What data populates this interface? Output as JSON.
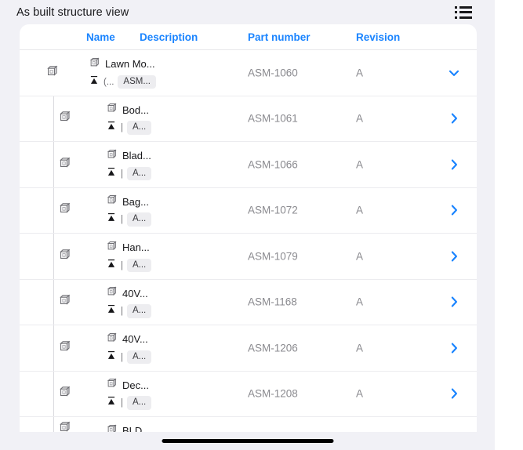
{
  "header": {
    "title": "As built structure view",
    "list_icon": "list-view-icon"
  },
  "table": {
    "columns": [
      {
        "key": "name",
        "label": "Name"
      },
      {
        "key": "description",
        "label": "Description"
      },
      {
        "key": "part_number",
        "label": "Part number"
      },
      {
        "key": "revision",
        "label": "Revision"
      }
    ],
    "rows": [
      {
        "level": 0,
        "name": "Lawn Mo...",
        "sub_prefix": "(...",
        "badge": "ASM...",
        "description": "",
        "part_number": "ASM-1060",
        "revision": "A",
        "expanded": true,
        "chevron": "chevron-down-icon"
      },
      {
        "level": 1,
        "name": "Bod...",
        "sub_prefix": "|",
        "badge": "A...",
        "description": "",
        "part_number": "ASM-1061",
        "revision": "A",
        "expanded": false,
        "chevron": "chevron-right-icon"
      },
      {
        "level": 1,
        "name": "Blad...",
        "sub_prefix": "|",
        "badge": "A...",
        "description": "",
        "part_number": "ASM-1066",
        "revision": "A",
        "expanded": false,
        "chevron": "chevron-right-icon"
      },
      {
        "level": 1,
        "name": "Bag...",
        "sub_prefix": "|",
        "badge": "A...",
        "description": "",
        "part_number": "ASM-1072",
        "revision": "A",
        "expanded": false,
        "chevron": "chevron-right-icon"
      },
      {
        "level": 1,
        "name": "Han...",
        "sub_prefix": "|",
        "badge": "A...",
        "description": "",
        "part_number": "ASM-1079",
        "revision": "A",
        "expanded": false,
        "chevron": "chevron-right-icon"
      },
      {
        "level": 1,
        "name": "40V...",
        "sub_prefix": "|",
        "badge": "A...",
        "description": "",
        "part_number": "ASM-1168",
        "revision": "A",
        "expanded": false,
        "chevron": "chevron-right-icon"
      },
      {
        "level": 1,
        "name": "40V...",
        "sub_prefix": "|",
        "badge": "A...",
        "description": "",
        "part_number": "ASM-1206",
        "revision": "A",
        "expanded": false,
        "chevron": "chevron-right-icon"
      },
      {
        "level": 1,
        "name": "Dec...",
        "sub_prefix": "|",
        "badge": "A...",
        "description": "",
        "part_number": "ASM-1208",
        "revision": "A",
        "expanded": false,
        "chevron": "chevron-right-icon"
      },
      {
        "level": 1,
        "name": "BLD...",
        "sub_prefix": "",
        "badge": "",
        "description": "",
        "part_number": "",
        "revision": "",
        "expanded": false,
        "chevron": "",
        "partial": true
      }
    ]
  },
  "colors": {
    "accent": "#1a84ff",
    "page_background": "#f1f1f6",
    "card_background": "#ffffff",
    "muted_text": "#8a8a8f",
    "badge_background": "#ededf0"
  },
  "home_indicator": "home-indicator"
}
